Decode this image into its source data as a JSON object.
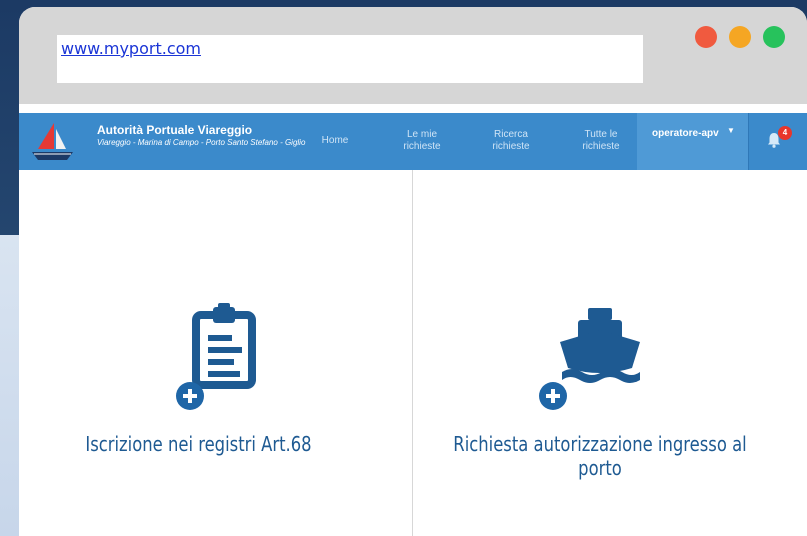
{
  "browser": {
    "url": "www.myport.com",
    "window_controls": [
      "close",
      "minimize",
      "maximize"
    ]
  },
  "navbar": {
    "brand_title": "Autorità Portuale Viareggio",
    "brand_subtitle": "Viareggio - Marina di Campo - Porto Santo Stefano - Giglio",
    "links": [
      {
        "label": "Home"
      },
      {
        "label": "Le mie richieste"
      },
      {
        "label": "Ricerca richieste"
      },
      {
        "label": "Tutte le richieste"
      }
    ],
    "user": {
      "label": "operatore-apv",
      "caret_icon": "caret-down-icon"
    },
    "notifications": {
      "icon": "bell-icon",
      "count": "4"
    }
  },
  "cards": [
    {
      "icon": "clipboard-icon",
      "action_icon": "plus-circle-icon",
      "label": "Iscrizione nei registri Art.68"
    },
    {
      "icon": "ship-icon",
      "action_icon": "plus-circle-icon",
      "label": "Richiesta autorizzazione ingresso al porto"
    }
  ],
  "colors": {
    "navbar": "#3b8acb",
    "navbar_user": "#4f9ad6",
    "icon": "#1e5a92",
    "plus": "#1f66a7",
    "badge": "#e8362b",
    "dot_red": "#f05a3f",
    "dot_yellow": "#f5a623",
    "dot_green": "#27c25c"
  }
}
